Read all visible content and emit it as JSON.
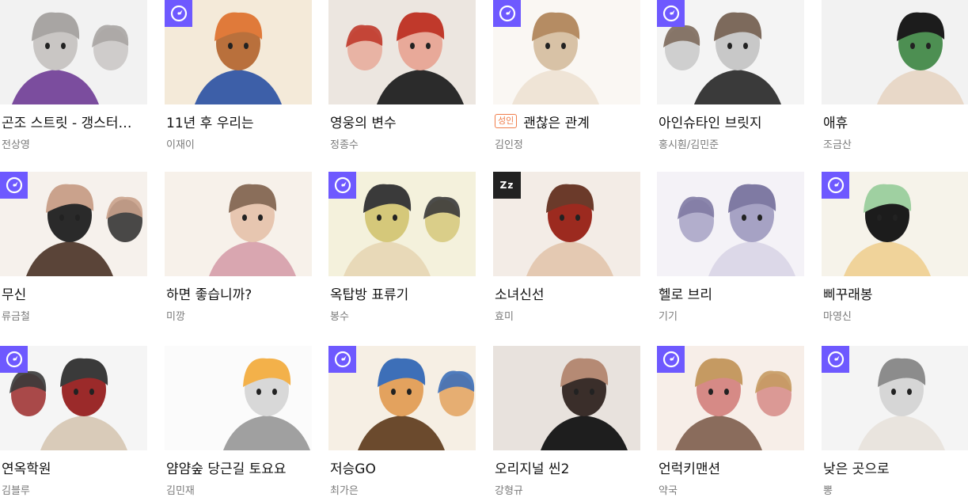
{
  "colors": {
    "timer_badge": "#6e59ff",
    "adult_badge": "#f07d4a",
    "title": "#111111",
    "author": "#7a7a7a"
  },
  "rows": [
    [
      {
        "title": "곤조 스트릿 - 갱스터…",
        "author": "전상영",
        "badge": "none",
        "palette": [
          "#f2f2f2",
          "#c9c6c4",
          "#a8a5a3",
          "#7b4d9e"
        ]
      },
      {
        "title": "11년 후 우리는",
        "author": "이재이",
        "badge": "timer-icon",
        "palette": [
          "#f4ead9",
          "#b9703c",
          "#e07a3a",
          "#3d5fa8"
        ]
      },
      {
        "title": "영웅의 변수",
        "author": "정종수",
        "badge": "none",
        "palette": [
          "#ece6e0",
          "#e8a999",
          "#c0392b",
          "#2b2b2b"
        ]
      },
      {
        "title": "괜찮은 관계",
        "adult_label": "성인",
        "author": "김인정",
        "badge": "timer-icon",
        "palette": [
          "#faf7f3",
          "#d8c2a6",
          "#b58c63",
          "#efe4d6"
        ]
      },
      {
        "title": "아인슈타인 브릿지",
        "author": "홍시훤/김민준",
        "badge": "timer-icon",
        "palette": [
          "#f4f4f4",
          "#c8c8c8",
          "#7d6a5c",
          "#3a3a3a"
        ]
      },
      {
        "title": "애휴",
        "author": "조금산",
        "badge": "none",
        "palette": [
          "#f2f2f2",
          "#4d8f52",
          "#1c1c1c",
          "#e8d8c8"
        ]
      }
    ],
    [
      {
        "title": "무신",
        "author": "류금철",
        "badge": "timer-icon",
        "palette": [
          "#f6f1ec",
          "#2a2a2a",
          "#caa28c",
          "#5a4438"
        ]
      },
      {
        "title": "하면 좋습니까?",
        "author": "미깡",
        "badge": "none",
        "palette": [
          "#f7f1ea",
          "#e7c6b0",
          "#8a6e5a",
          "#d9a6b0"
        ]
      },
      {
        "title": "옥탑방 표류기",
        "author": "봉수",
        "badge": "timer-icon",
        "palette": [
          "#f4f1dc",
          "#d5c87a",
          "#3a3a3a",
          "#e8d9b8"
        ]
      },
      {
        "title": "소녀신선",
        "author": "효미",
        "badge": "zz",
        "zz_label": "Zz",
        "palette": [
          "#f3ece6",
          "#9c2a1f",
          "#6b3a2a",
          "#e4c9b2"
        ]
      },
      {
        "title": "헬로 브리",
        "author": "기기",
        "badge": "none",
        "palette": [
          "#f4f2f7",
          "#a6a2c4",
          "#7f7aa3",
          "#dcd8e8"
        ]
      },
      {
        "title": "삐꾸래봉",
        "author": "마영신",
        "badge": "timer-icon",
        "palette": [
          "#f6f3ea",
          "#1c1c1c",
          "#9fd0a1",
          "#f0d39a"
        ]
      }
    ],
    [
      {
        "title": "연옥학원",
        "author": "김블루",
        "badge": "timer-icon",
        "palette": [
          "#f5f5f5",
          "#9b2a2a",
          "#3a3a3a",
          "#d9cbb9"
        ]
      },
      {
        "title": "얌얌숲 당근길 토요요",
        "author": "김민재",
        "badge": "none",
        "palette": [
          "#fbfbfb",
          "#d8d8d8",
          "#f3b14a",
          "#a0a0a0"
        ]
      },
      {
        "title": "저승GO",
        "author": "최가은",
        "badge": "timer-icon",
        "palette": [
          "#f6efe4",
          "#e3a25e",
          "#3d6fb8",
          "#6b4a2d"
        ]
      },
      {
        "title": "오리지널 씬2",
        "author": "강형규",
        "badge": "none",
        "palette": [
          "#e8e2dd",
          "#3a2e2a",
          "#b58a74",
          "#1e1e1e"
        ]
      },
      {
        "title": "언럭키맨션",
        "author": "약국",
        "badge": "timer-icon",
        "palette": [
          "#f7eee8",
          "#d68a86",
          "#c59a62",
          "#8a6c5c"
        ]
      },
      {
        "title": "낮은 곳으로",
        "author": "뽕",
        "badge": "timer-icon",
        "palette": [
          "#f4f4f4",
          "#d6d6d6",
          "#8c8c8c",
          "#e9e4de"
        ]
      }
    ]
  ]
}
